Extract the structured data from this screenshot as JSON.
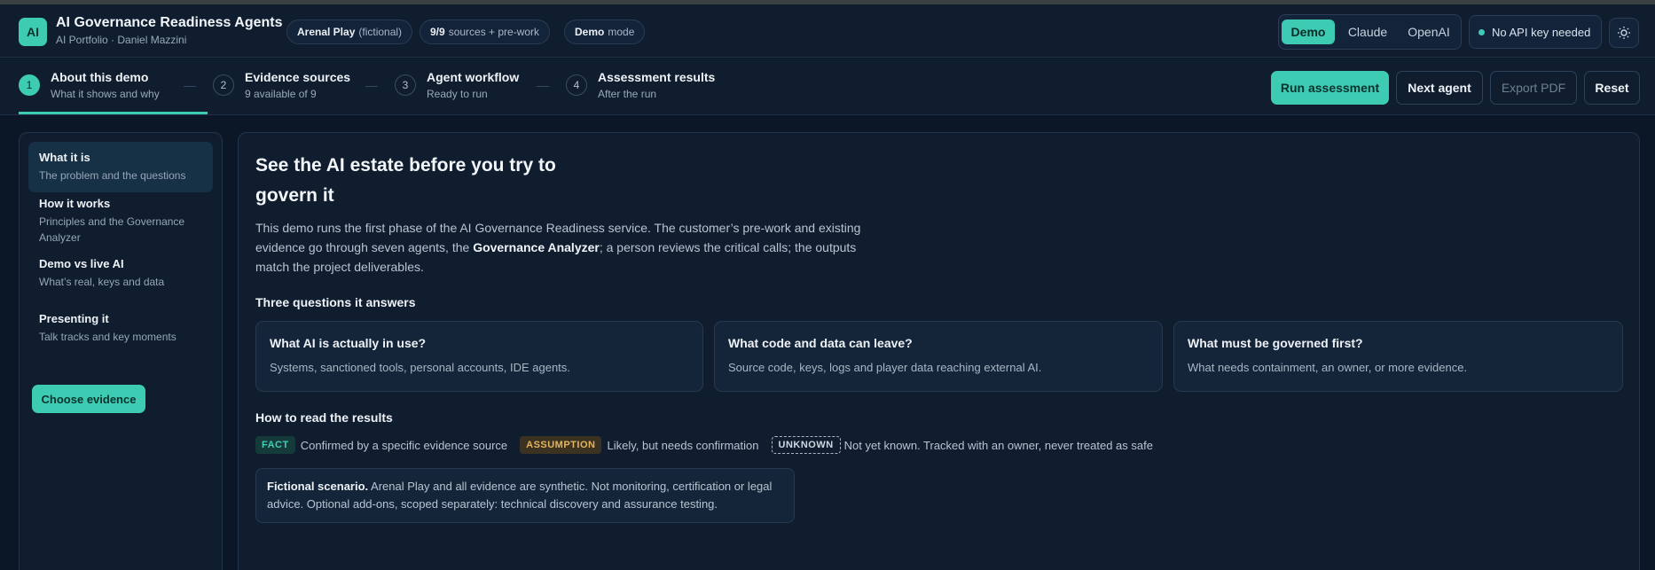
{
  "header": {
    "logo_text": "AI",
    "title": "AI Governance Readiness Agents",
    "subtitle": "AI Portfolio · Daniel Mazzini",
    "chips": [
      {
        "bold": "Arenal Play",
        "text": "(fictional)"
      },
      {
        "bold": "9/9",
        "text": "sources + pre-work"
      },
      {
        "bold": "Demo",
        "text": "mode"
      }
    ],
    "mode_options": [
      "Demo",
      "Claude",
      "OpenAI"
    ],
    "mode_selected": "Demo",
    "api_status": "No API key needed",
    "theme_icon": "sun-icon"
  },
  "steps": [
    {
      "num": "1",
      "title": "About this demo",
      "sub": "What it shows and why",
      "active": true
    },
    {
      "num": "2",
      "title": "Evidence sources",
      "sub": "9 available of 9",
      "active": false
    },
    {
      "num": "3",
      "title": "Agent workflow",
      "sub": "Ready to run",
      "active": false
    },
    {
      "num": "4",
      "title": "Assessment results",
      "sub": "After the run",
      "active": false
    }
  ],
  "toolbar": {
    "run": "Run assessment",
    "next": "Next agent",
    "export": "Export PDF",
    "reset": "Reset"
  },
  "sidebar": {
    "items": [
      {
        "title": "What it is",
        "desc": "The problem and the questions"
      },
      {
        "title": "How it works",
        "desc": "Principles and the Governance Analyzer"
      },
      {
        "title": "Demo vs live AI",
        "desc": "What’s real, keys and data"
      },
      {
        "title": "Presenting it",
        "desc": "Talk tracks and key moments"
      }
    ],
    "cta": "Choose evidence"
  },
  "main": {
    "title": "See the AI estate before you try to govern it",
    "intro_1": "This demo runs the first phase of the AI Governance Readiness service. The customer’s pre-work and existing evidence go through seven agents, the ",
    "intro_bold": "Governance Analyzer",
    "intro_2": "; a person reviews the critical calls; the outputs match the project deliverables.",
    "questions_heading": "Three questions it answers",
    "questions": [
      {
        "title": "What AI is actually in use?",
        "desc": "Systems, sanctioned tools, personal accounts, IDE agents."
      },
      {
        "title": "What code and data can leave?",
        "desc": "Source code, keys, logs and player data reaching external AI."
      },
      {
        "title": "What must be governed first?",
        "desc": "What needs containment, an owner, or more evidence."
      }
    ],
    "read_heading": "How to read the results",
    "legend": [
      {
        "badge": "FACT",
        "text": "Confirmed by a specific evidence source"
      },
      {
        "badge": "ASSUMPTION",
        "text": "Likely, but needs confirmation"
      },
      {
        "badge": "UNKNOWN",
        "text": "Not yet known. Tracked with an owner, never treated as safe"
      }
    ],
    "note_bold": "Fictional scenario.",
    "note_text": " Arenal Play and all evidence are synthetic. Not monitoring, certification or legal advice. Optional add-ons, scoped separately: technical discovery and assurance testing."
  },
  "colors": {
    "accent": "#3ecbb4",
    "background": "#0b1726",
    "panel": "#0f1d2f",
    "assumption": "#e5b45c"
  }
}
